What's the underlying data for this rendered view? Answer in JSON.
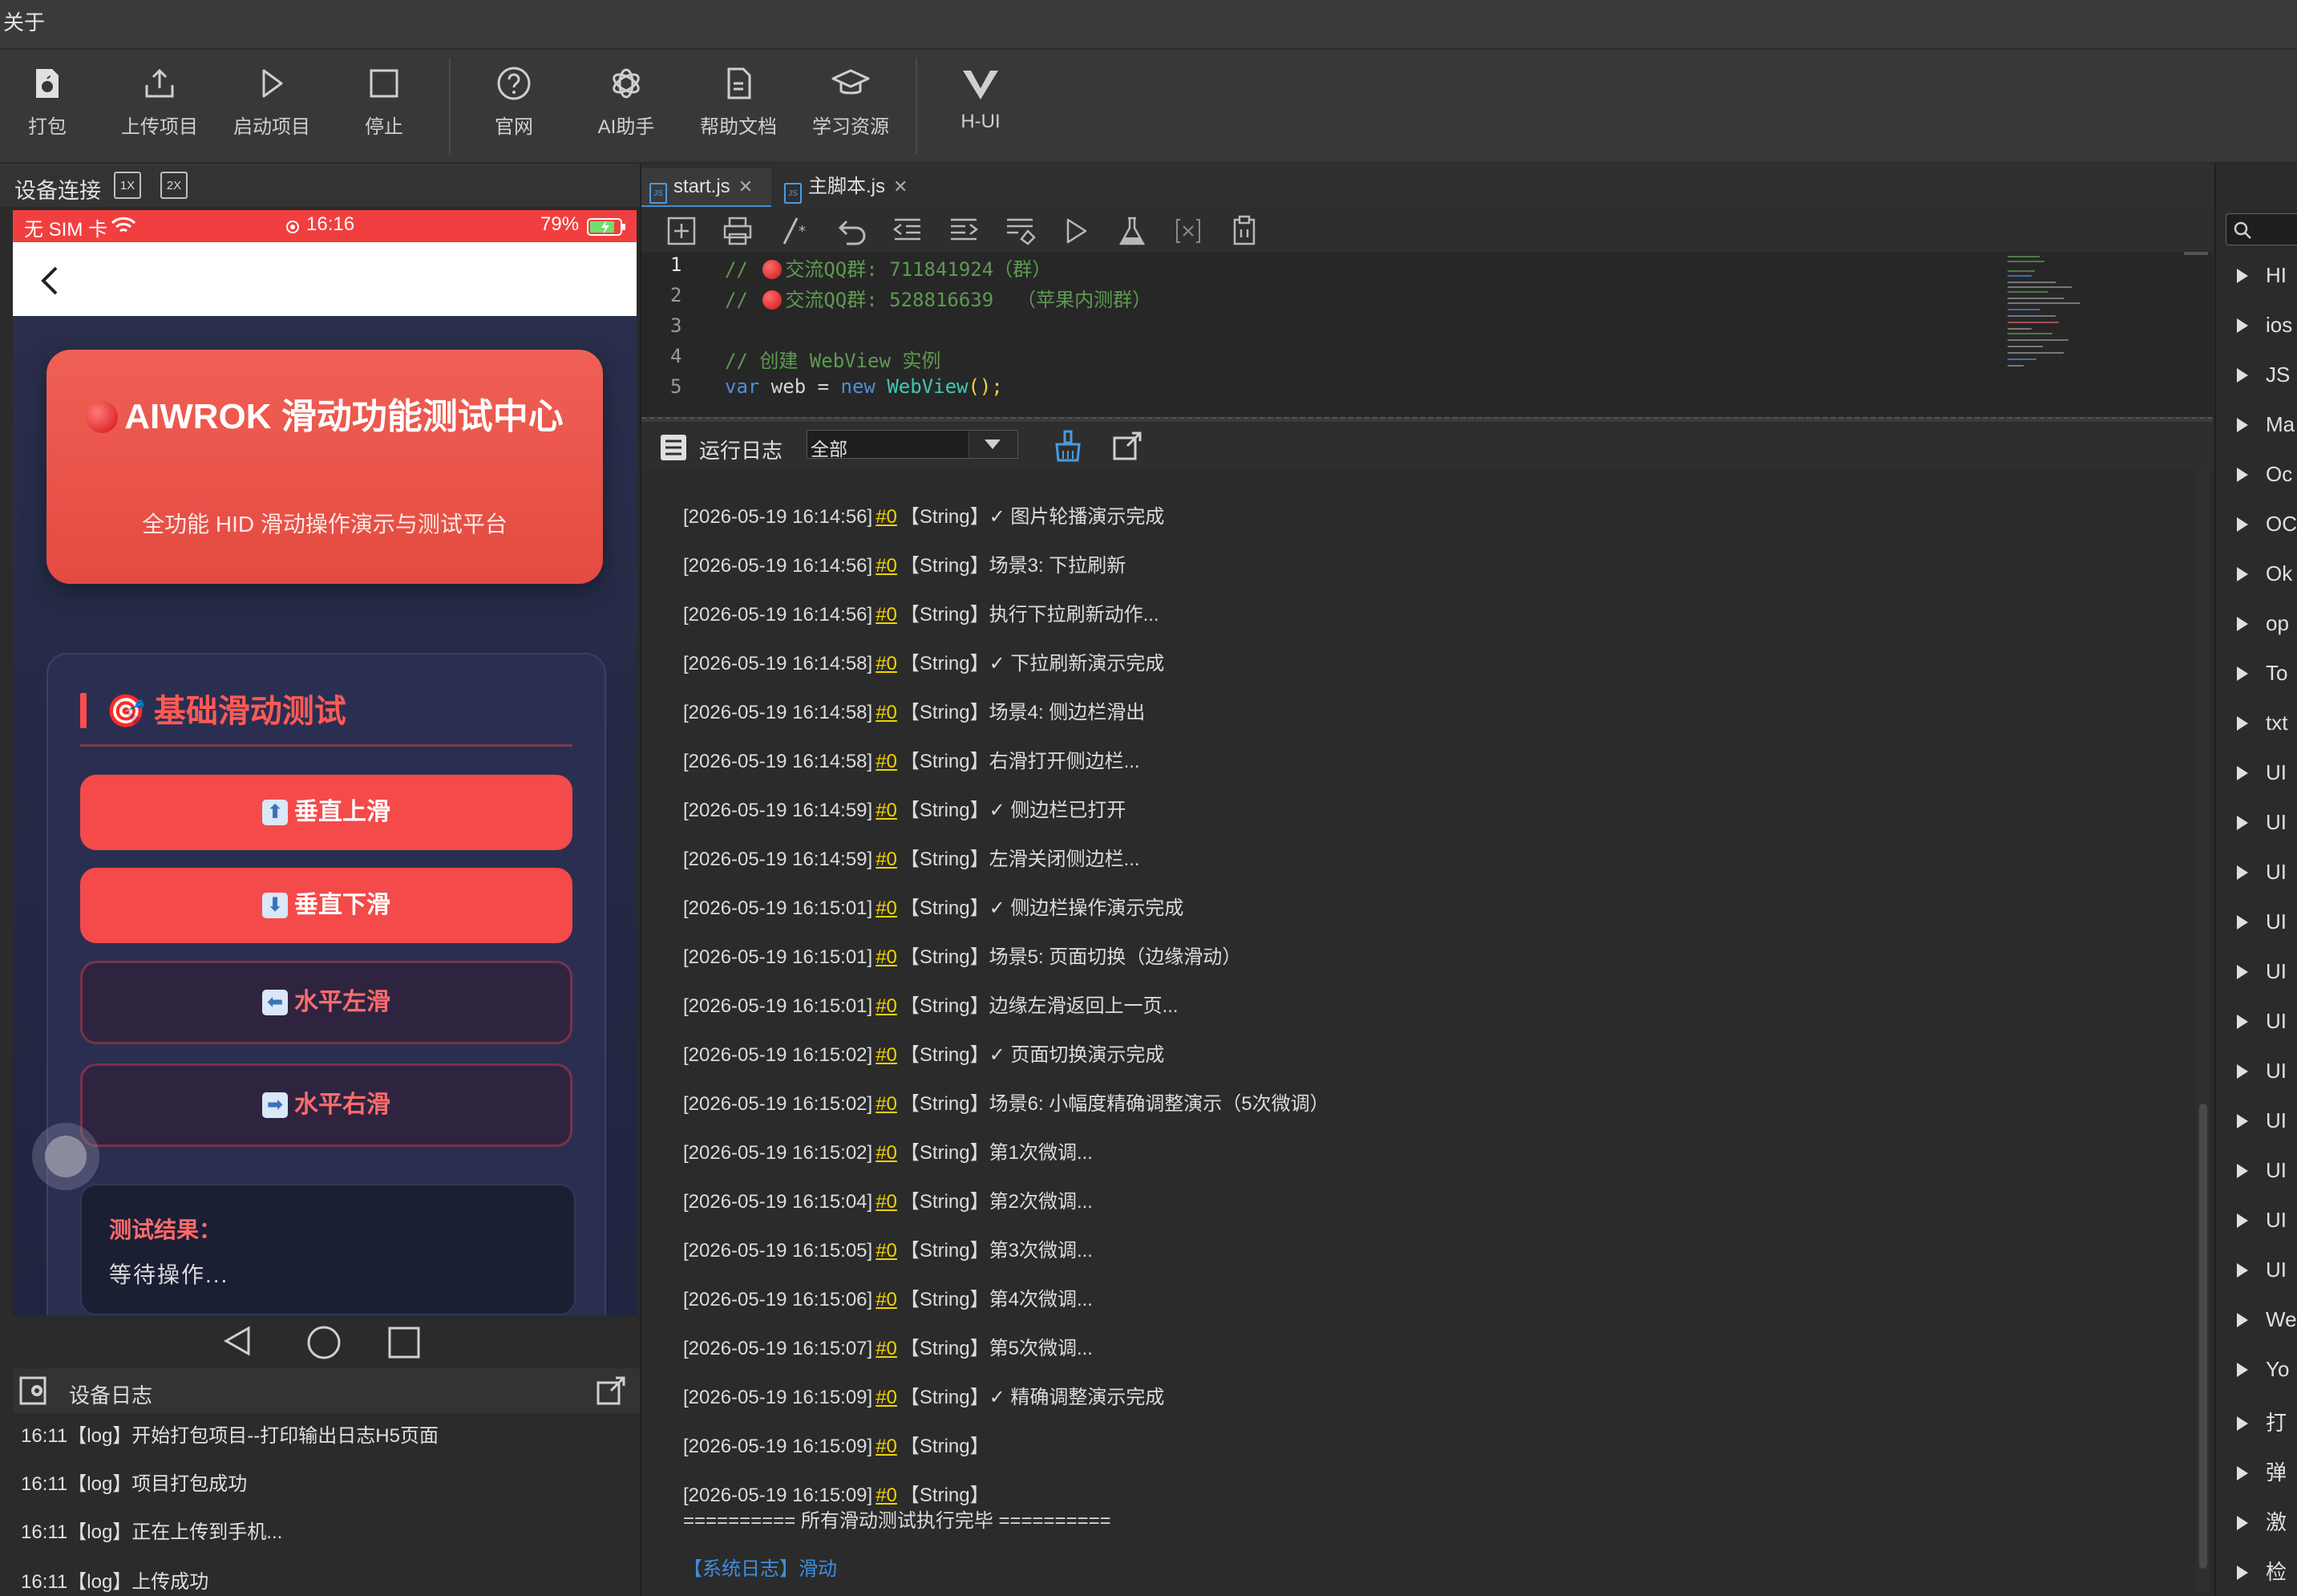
{
  "menu": {
    "about": "关于"
  },
  "toolbar": {
    "pack": "打包",
    "upload": "上传项目",
    "start": "启动项目",
    "stop": "停止",
    "website": "官网",
    "ai": "AI助手",
    "docs": "帮助文档",
    "learn": "学习资源",
    "hui": "H-UI"
  },
  "device": {
    "tab_label": "设备连接",
    "scale_1x": "1X",
    "scale_2x": "2X",
    "status": {
      "carrier": "无 SIM 卡",
      "time": "16:16",
      "battery": "79%"
    },
    "hero": {
      "title": "AIWROK 滑动功能测试中心",
      "subtitle": "全功能 HID 滑动操作演示与测试平台"
    },
    "section_title": "基础滑动测试",
    "buttons": [
      {
        "label": "垂直上滑",
        "arrow": "⬆"
      },
      {
        "label": "垂直下滑",
        "arrow": "⬇"
      },
      {
        "label": "水平左滑",
        "arrow": "⬅"
      },
      {
        "label": "水平右滑",
        "arrow": "➡"
      }
    ],
    "result_label": "测试结果：",
    "result_value": "等待操作..."
  },
  "device_log": {
    "title": "设备日志",
    "lines": [
      "16:11【log】开始打包项目--打印输出日志H5页面",
      "16:11【log】项目打包成功",
      "16:11【log】正在上传到手机...",
      "16:11【log】上传成功"
    ]
  },
  "editor": {
    "tabs": [
      {
        "name": "start.js",
        "active": true
      },
      {
        "name": "主脚本.js",
        "active": false
      }
    ],
    "code": {
      "l1_comment": "// ",
      "l1_text": "交流QQ群: 711841924（群）",
      "l2_comment": "// ",
      "l2_text": "交流QQ群: 528816639  （苹果内测群）",
      "l4": "// 创建 WebView 实例",
      "l5_kw": "var",
      "l5_mid": " web = ",
      "l5_new": "new",
      "l5_cls": "WebView",
      "l5_end": "();"
    },
    "line_numbers": [
      "1",
      "2",
      "3",
      "4",
      "5"
    ]
  },
  "run_log": {
    "title": "运行日志",
    "filter": "全部",
    "entries": [
      {
        "ts": "[2026-05-19 16:14:56]",
        "tag": "#0",
        "msg": "【String】✓ 图片轮播演示完成"
      },
      {
        "ts": "[2026-05-19 16:14:56]",
        "tag": "#0",
        "msg": "【String】场景3: 下拉刷新"
      },
      {
        "ts": "[2026-05-19 16:14:56]",
        "tag": "#0",
        "msg": "【String】执行下拉刷新动作..."
      },
      {
        "ts": "[2026-05-19 16:14:58]",
        "tag": "#0",
        "msg": "【String】✓ 下拉刷新演示完成"
      },
      {
        "ts": "[2026-05-19 16:14:58]",
        "tag": "#0",
        "msg": "【String】场景4: 侧边栏滑出"
      },
      {
        "ts": "[2026-05-19 16:14:58]",
        "tag": "#0",
        "msg": "【String】右滑打开侧边栏..."
      },
      {
        "ts": "[2026-05-19 16:14:59]",
        "tag": "#0",
        "msg": "【String】✓ 侧边栏已打开"
      },
      {
        "ts": "[2026-05-19 16:14:59]",
        "tag": "#0",
        "msg": "【String】左滑关闭侧边栏..."
      },
      {
        "ts": "[2026-05-19 16:15:01]",
        "tag": "#0",
        "msg": "【String】✓ 侧边栏操作演示完成"
      },
      {
        "ts": "[2026-05-19 16:15:01]",
        "tag": "#0",
        "msg": "【String】场景5: 页面切换（边缘滑动）"
      },
      {
        "ts": "[2026-05-19 16:15:01]",
        "tag": "#0",
        "msg": "【String】边缘左滑返回上一页..."
      },
      {
        "ts": "[2026-05-19 16:15:02]",
        "tag": "#0",
        "msg": "【String】✓ 页面切换演示完成"
      },
      {
        "ts": "[2026-05-19 16:15:02]",
        "tag": "#0",
        "msg": "【String】场景6: 小幅度精确调整演示（5次微调）"
      },
      {
        "ts": "[2026-05-19 16:15:02]",
        "tag": "#0",
        "msg": "【String】第1次微调..."
      },
      {
        "ts": "[2026-05-19 16:15:04]",
        "tag": "#0",
        "msg": "【String】第2次微调..."
      },
      {
        "ts": "[2026-05-19 16:15:05]",
        "tag": "#0",
        "msg": "【String】第3次微调..."
      },
      {
        "ts": "[2026-05-19 16:15:06]",
        "tag": "#0",
        "msg": "【String】第4次微调..."
      },
      {
        "ts": "[2026-05-19 16:15:07]",
        "tag": "#0",
        "msg": "【String】第5次微调..."
      },
      {
        "ts": "[2026-05-19 16:15:09]",
        "tag": "#0",
        "msg": "【String】✓ 精确调整演示完成"
      },
      {
        "ts": "[2026-05-19 16:15:09]",
        "tag": "#0",
        "msg": "【String】"
      },
      {
        "ts": "[2026-05-19 16:15:09]",
        "tag": "#0",
        "msg": "【String】"
      }
    ],
    "separator": "========== 所有滑动测试执行完毕 ==========",
    "system": "【系统日志】滑动"
  },
  "sidebar": {
    "items": [
      "HI",
      "ios",
      "JS",
      "Ma",
      "Oc",
      "OC",
      "Ok",
      "op",
      "To",
      "txt",
      "UI",
      "UI",
      "UI",
      "UI",
      "UI",
      "UI",
      "UI",
      "UI",
      "UI",
      "UI",
      "UI",
      "We",
      "Yo",
      "打",
      "弹",
      "激",
      "检"
    ]
  },
  "colors": {
    "accent": "#f44a4a",
    "link": "#3d8fe0",
    "tag": "#f2d300",
    "comment": "#5e9a52"
  },
  "icons": [
    "apple-icon",
    "upload-icon",
    "play-icon",
    "stop-icon",
    "help-icon",
    "openai-icon",
    "document-icon",
    "graduation-cap-icon",
    "vue-icon"
  ]
}
